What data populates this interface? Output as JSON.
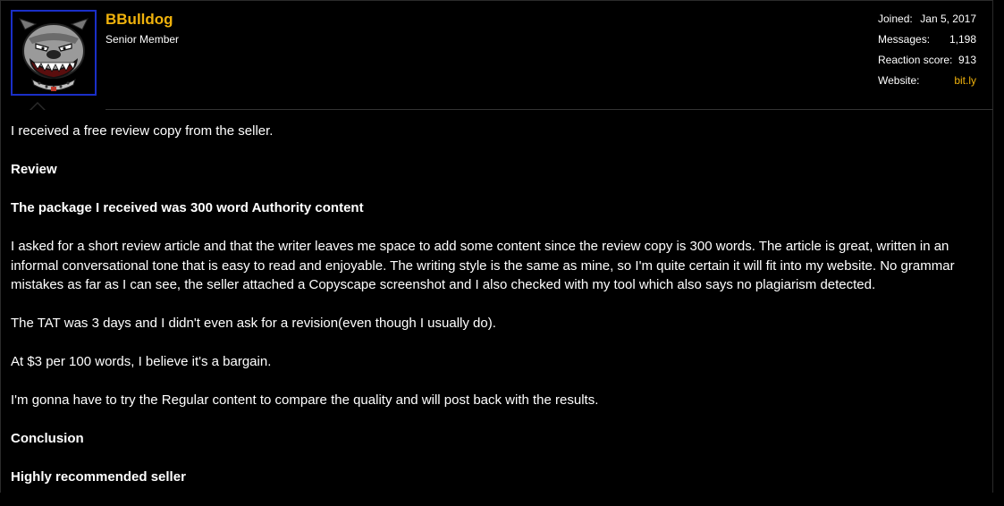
{
  "user": {
    "name": "BBulldog",
    "title": "Senior Member"
  },
  "stats": [
    {
      "label": "Joined:",
      "value": "Jan 5, 2017"
    },
    {
      "label": "Messages:",
      "value": "1,198"
    },
    {
      "label": "Reaction score:",
      "value": "913"
    },
    {
      "label": "Website:",
      "value": "bit.ly"
    }
  ],
  "post": {
    "paragraphs": [
      {
        "text": "I received a free review copy from the seller.",
        "bold": false
      },
      {
        "text": "Review",
        "bold": true
      },
      {
        "text": "The package I received was 300 word Authority content",
        "bold": true
      },
      {
        "text": "I asked for a short review article and that the writer leaves me space to add some content since the review copy is 300 words. The article is great, written in an informal conversational tone that is easy to read and enjoyable. The writing style is the same as mine, so I'm quite certain it will fit into my website. No grammar mistakes as far as I can see, the seller attached a Copyscape screenshot and I also checked with my tool which also says no plagiarism detected.",
        "bold": false
      },
      {
        "text": "The TAT was 3 days and I didn't even ask for a revision(even though I usually do).",
        "bold": false
      },
      {
        "text": "At $3 per 100 words, I believe it's a bargain.",
        "bold": false
      },
      {
        "text": "I'm gonna have to try the Regular content to compare the quality and will post back with the results.",
        "bold": false
      },
      {
        "text": "Conclusion",
        "bold": true
      },
      {
        "text": "Highly recommended seller",
        "bold": true
      }
    ]
  },
  "colors": {
    "accent": "#f0b20c",
    "avatar_border": "#1a2fc8",
    "background": "#000000"
  },
  "icons": {
    "avatar": "bulldog-mascot-icon"
  }
}
